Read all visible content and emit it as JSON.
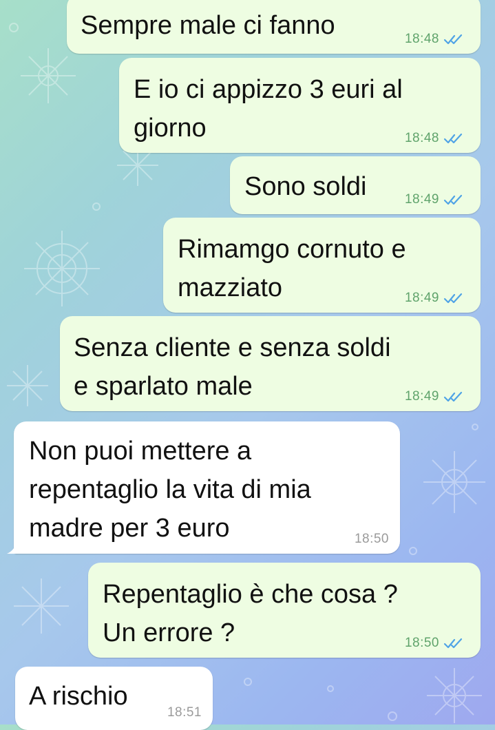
{
  "messages": [
    {
      "direction": "out",
      "text": "Sempre male ci fanno",
      "time": "18:48",
      "status": "read"
    },
    {
      "direction": "out",
      "text": "E io ci appizzo 3 euri al\ngiorno",
      "time": "18:48",
      "status": "read"
    },
    {
      "direction": "out",
      "text": "Sono soldi",
      "time": "18:49",
      "status": "read"
    },
    {
      "direction": "out",
      "text": "Rimamgo cornuto e\nmazziato",
      "time": "18:49",
      "status": "read"
    },
    {
      "direction": "out",
      "text": "Senza cliente e senza soldi\ne sparlato male",
      "time": "18:49",
      "status": "read"
    },
    {
      "direction": "in",
      "text": "Non puoi mettere a\nrepentaglio la vita di mia\nmadre per 3 euro",
      "time": "18:50"
    },
    {
      "direction": "out",
      "text": "Repentaglio è che cosa ?\nUn errore ?",
      "time": "18:50",
      "status": "read"
    },
    {
      "direction": "in",
      "text": "A rischio",
      "time": "18:51"
    }
  ],
  "colors": {
    "outgoing_bubble": "#eefde2",
    "incoming_bubble": "#ffffff",
    "outgoing_time": "#5fa36b",
    "read_check": "#4fa3e6",
    "incoming_time": "#9a9a9a"
  },
  "icons": {
    "read_status": "double-check-icon",
    "wallpaper": "snowflake-pattern"
  }
}
